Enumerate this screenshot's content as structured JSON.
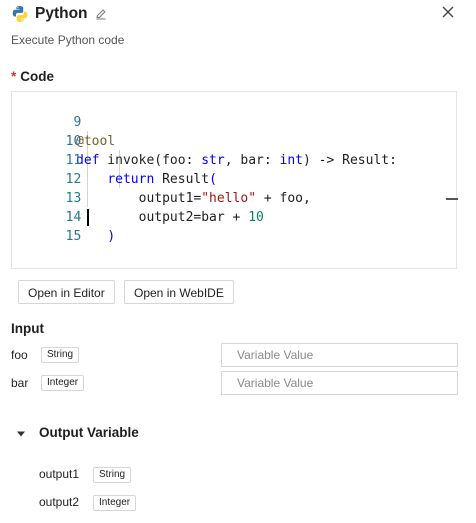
{
  "header": {
    "title": "Python",
    "subtitle": "Execute Python code",
    "icon": "python-logo-icon",
    "edit_icon": "pencil-edit-icon",
    "close_icon": "close-icon"
  },
  "code_section": {
    "required_marker": "*",
    "label": "Code",
    "lines": [
      {
        "num": "9",
        "text": "@tool"
      },
      {
        "num": "10",
        "text": "def invoke(foo: str, bar: int) -> Result:"
      },
      {
        "num": "11",
        "text": "    return Result("
      },
      {
        "num": "12",
        "text": "        output1=\"hello\" + foo,"
      },
      {
        "num": "13",
        "text": "        output2=bar + 10"
      },
      {
        "num": "14",
        "text": "    )"
      },
      {
        "num": "15",
        "text": ""
      }
    ]
  },
  "buttons": {
    "open_editor": "Open in Editor",
    "open_webide": "Open in WebIDE"
  },
  "input_section": {
    "label": "Input",
    "params": [
      {
        "name": "foo",
        "type": "String",
        "placeholder": "Variable Value",
        "value": ""
      },
      {
        "name": "bar",
        "type": "Integer",
        "placeholder": "Variable Value",
        "value": ""
      }
    ]
  },
  "output_section": {
    "label": "Output Variable",
    "expanded": true,
    "vars": [
      {
        "name": "output1",
        "type": "String"
      },
      {
        "name": "output2",
        "type": "Integer"
      }
    ]
  },
  "colors": {
    "required": "#d13438",
    "line_number": "#237893",
    "keyword": "#0000ff",
    "string": "#a31515",
    "number": "#098658",
    "decorator": "#795e26"
  }
}
